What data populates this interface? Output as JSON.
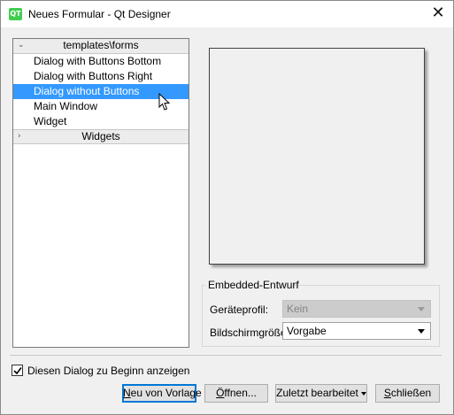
{
  "window": {
    "title": "Neues Formular - Qt Designer",
    "app_icon_text": "QT"
  },
  "tree": {
    "groups": [
      {
        "label": "templates\\forms",
        "expanded": true,
        "items": [
          "Dialog with Buttons Bottom",
          "Dialog with Buttons Right",
          "Dialog without Buttons",
          "Main Window",
          "Widget"
        ]
      },
      {
        "label": "Widgets",
        "expanded": false,
        "items": []
      }
    ],
    "selected_item": "Dialog without Buttons"
  },
  "embedded": {
    "group_title": "Embedded-Entwurf",
    "device_profile_label": "Geräteprofil:",
    "device_profile_value": "Kein",
    "screen_size_label": "Bildschirmgröße:",
    "screen_size_value": "Vorgabe"
  },
  "startup_checkbox": {
    "label": "Diesen Dialog zu Beginn anzeigen",
    "checked": true
  },
  "buttons": {
    "new_from_template": {
      "mnemonic": "N",
      "rest": "eu von Vorlage"
    },
    "open": {
      "mnemonic": "Ö",
      "rest": "ffnen..."
    },
    "recent": {
      "label": "Zuletzt bearbeitet"
    },
    "close": {
      "mnemonic": "S",
      "rest": "chließen"
    }
  },
  "colors": {
    "selection": "#3399ff",
    "default_button_border": "#0078d7",
    "app_icon": "#41cd52"
  }
}
